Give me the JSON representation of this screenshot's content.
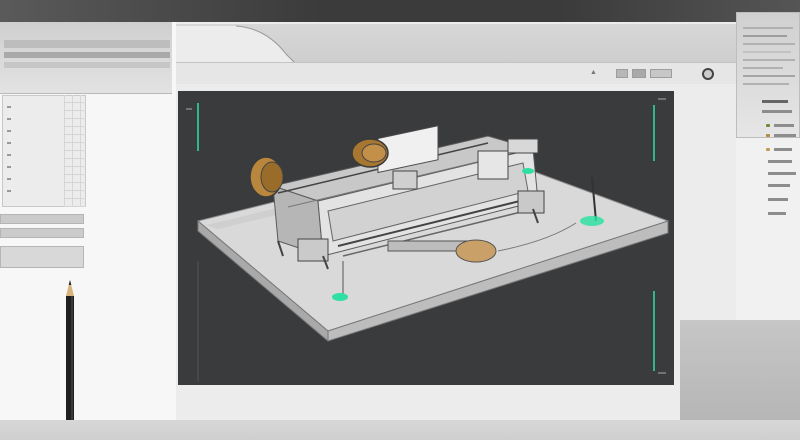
{
  "app": {
    "title": "",
    "colors": {
      "accent": "#2fe0a2",
      "viewport_bg": "#3a3b3d",
      "chrome": "#ececec",
      "top_band": "#3d3d3e"
    }
  },
  "icons": {
    "window_buttons": [
      "minimize-icon",
      "restore-icon",
      "settings-knob-icon"
    ],
    "tool": "pencil-icon"
  },
  "viewport": {
    "label": "",
    "corner_marks": "accent"
  },
  "left_panel": {
    "tree_rows": 8
  },
  "right_panel": {
    "rows": 10
  }
}
